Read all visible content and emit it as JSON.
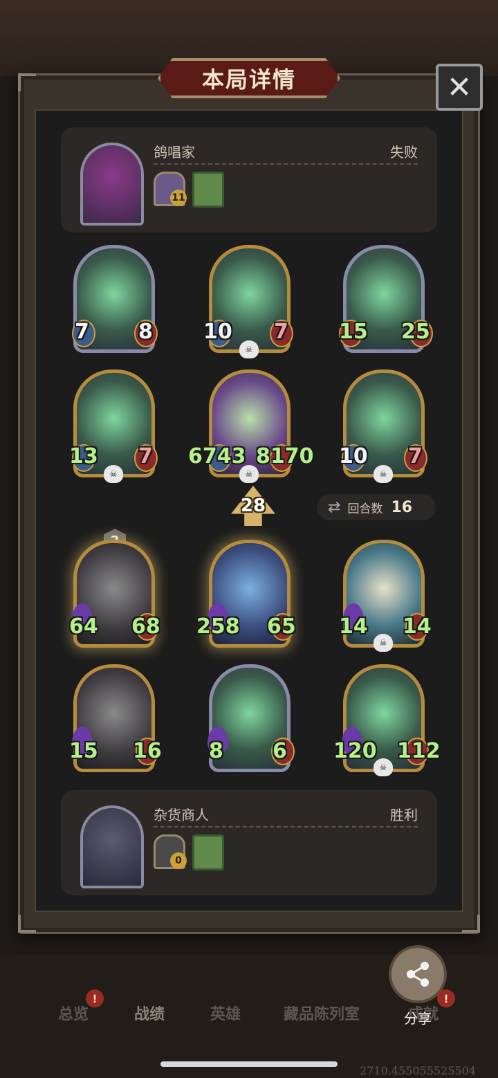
{
  "dialog": {
    "title": "本局详情",
    "close_icon": "close-icon"
  },
  "top_player": {
    "name": "鸽唱家",
    "result": "失败",
    "relic_badge": "11",
    "relic_icon": "relic-icon",
    "book_icon": "book-icon"
  },
  "top_board": [
    {
      "atk": "7",
      "hp": "8"
    },
    {
      "atk": "10",
      "hp": "7"
    },
    {
      "atk": "15",
      "hp": "25"
    },
    {
      "atk": "13",
      "hp": "7"
    },
    {
      "atk": "6743",
      "hp": "8170"
    },
    {
      "atk": "10",
      "hp": "7"
    }
  ],
  "center": {
    "damage": "28",
    "rounds_label": "回合数",
    "rounds_value": "16"
  },
  "bottom_board": [
    {
      "atk": "64",
      "hp": "68",
      "tier": "2"
    },
    {
      "atk": "258",
      "hp": "65"
    },
    {
      "atk": "14",
      "hp": "14"
    },
    {
      "atk": "15",
      "hp": "16"
    },
    {
      "atk": "8",
      "hp": "6"
    },
    {
      "atk": "120",
      "hp": "112"
    }
  ],
  "bottom_player": {
    "name": "杂货商人",
    "result": "胜利",
    "relic_badge": "0",
    "relic_icon": "relic-icon",
    "book_icon": "book-icon"
  },
  "tabs": [
    {
      "label": "总览"
    },
    {
      "label": "战绩"
    },
    {
      "label": "英雄"
    },
    {
      "label": "藏品陈列室"
    },
    {
      "label": "成就"
    }
  ],
  "share": {
    "label": "分享",
    "icon": "share-icon"
  },
  "watermark": "2710.455055525504"
}
